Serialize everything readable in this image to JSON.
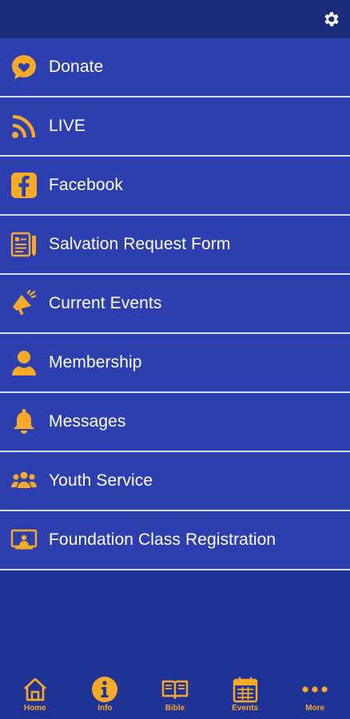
{
  "colors": {
    "accent": "#f7a928",
    "header": "#1b2b7e",
    "row": "#2d3fae",
    "background": "#1f3296",
    "divider": "#d4daf4"
  },
  "header": {
    "settings_icon": "gear-icon"
  },
  "menu": {
    "items": [
      {
        "label": "Donate",
        "icon": "heart-chat-icon"
      },
      {
        "label": "LIVE",
        "icon": "rss-icon"
      },
      {
        "label": "Facebook",
        "icon": "facebook-icon"
      },
      {
        "label": "Salvation Request Form",
        "icon": "form-icon"
      },
      {
        "label": "Current Events",
        "icon": "megaphone-icon"
      },
      {
        "label": "Membership",
        "icon": "person-icon"
      },
      {
        "label": "Messages",
        "icon": "bell-icon"
      },
      {
        "label": "Youth Service",
        "icon": "group-icon"
      },
      {
        "label": "Foundation Class Registration",
        "icon": "presentation-icon"
      }
    ]
  },
  "tabbar": {
    "tabs": [
      {
        "label": "Home",
        "icon": "home-icon"
      },
      {
        "label": "Info",
        "icon": "info-icon"
      },
      {
        "label": "Bible",
        "icon": "book-icon"
      },
      {
        "label": "Events",
        "icon": "calendar-icon"
      },
      {
        "label": "More",
        "icon": "more-icon"
      }
    ]
  }
}
